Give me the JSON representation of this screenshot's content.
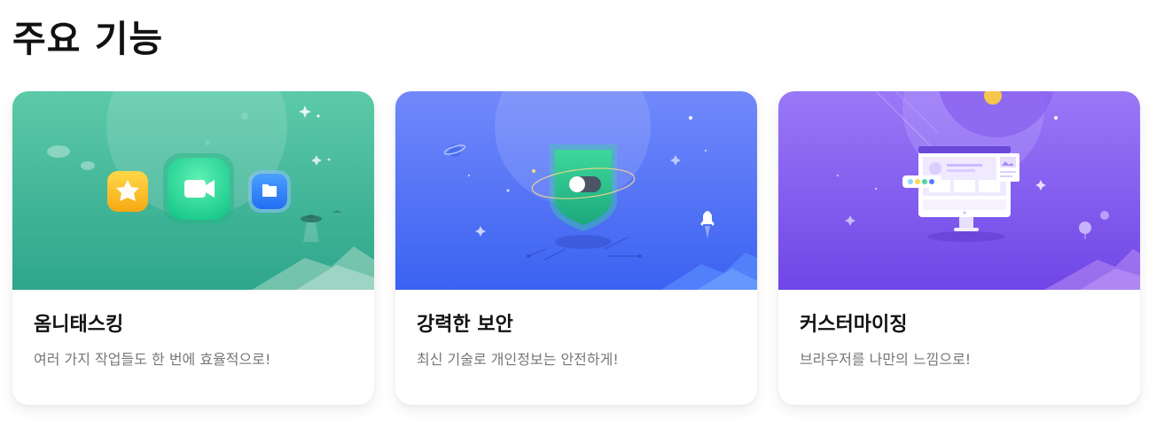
{
  "section": {
    "title": "주요 기능"
  },
  "cards": [
    {
      "title": "옴니태스킹",
      "description": "여러 가지 작업들도 한 번에 효율적으로!",
      "illustration": "multitasking-app-icons",
      "colors": {
        "bg_from": "#55c9a6",
        "bg_to": "#2fa88e"
      }
    },
    {
      "title": "강력한 보안",
      "description": "최신 기술로 개인정보는 안전하게!",
      "illustration": "security-shield-toggle",
      "colors": {
        "bg_from": "#6f88fb",
        "bg_to": "#3b63f2"
      }
    },
    {
      "title": "커스터마이징",
      "description": "브라우저를 나만의 느낌으로!",
      "illustration": "customize-monitor",
      "colors": {
        "bg_from": "#9672f6",
        "bg_to": "#7048e6"
      }
    }
  ]
}
